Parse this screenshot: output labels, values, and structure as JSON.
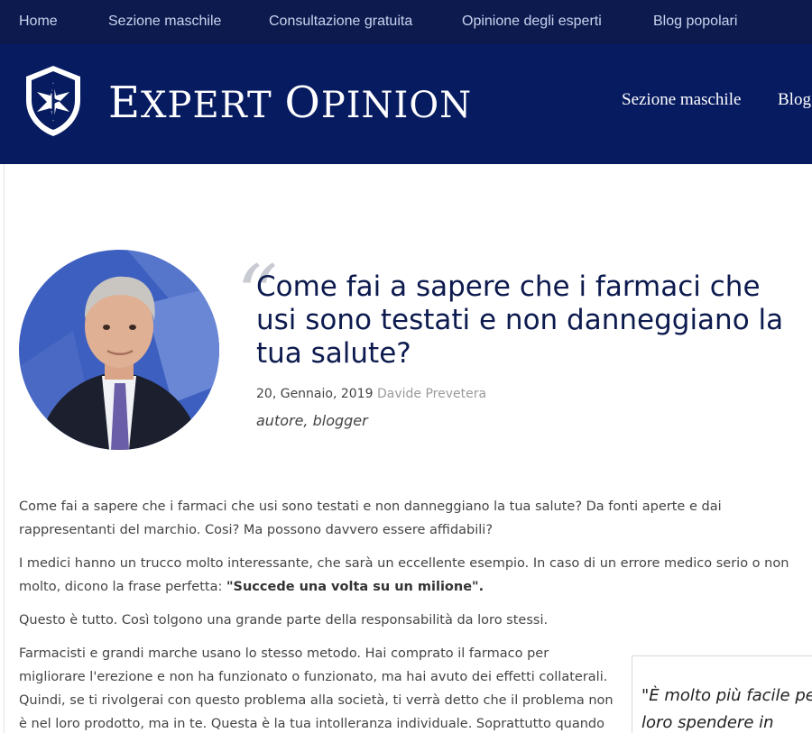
{
  "topbar": {
    "items": [
      "Home",
      "Sezione maschile",
      "Consultazione gratuita",
      "Opinione degli esperti",
      "Blog popolari"
    ]
  },
  "header": {
    "logo_text_e": "E",
    "logo_text_xpert": "XPERT ",
    "logo_text_o": "O",
    "logo_text_pinion": "PINION",
    "nav": [
      "Sezione maschile",
      "Blog"
    ]
  },
  "article": {
    "title": "Come fai a sapere che i farmaci che usi sono testati e non danneggiano la tua salute?",
    "date": "20, Gennaio, 2019",
    "author": "Davide Prevetera",
    "role": "autore, blogger",
    "paragraphs": [
      "Come fai a sapere che i farmaci che usi sono testati e non danneggiano la tua salute? Da fonti aperte e dai rappresentanti del marchio. Cosi? Ma possono davvero essere affidabili?",
      "I medici hanno un trucco molto interessante, che sarà un eccellente esempio. In caso di un errore medico serio o non molto, dicono la frase perfetta:",
      "Questo è tutto. Così tolgono una grande parte della responsabilità da loro stessi.",
      "Farmacisti e grandi marche usano lo stesso metodo. Hai comprato il farmaco per migliorare l'erezione e non ha funzionato o funzionato, ma hai avuto dei effetti collaterali. Quindi, se ti rivolgerai con questo problema alla società, ti verrà detto che il problema non è nel loro prodotto, ma in te. Questa è la tua intolleranza individuale. Soprattutto quando si tratta di"
    ],
    "p2_bold": "\"Succede una volta su un milione\"."
  },
  "sidebar": {
    "quote_line1": "\"È molto più facile per",
    "quote_line2": "loro spendere in"
  },
  "colors": {
    "topbar_bg": "#0c1a4e",
    "header_bg": "#071b61",
    "title_color": "#0c1a4e",
    "author_color": "#9a9a9a"
  }
}
